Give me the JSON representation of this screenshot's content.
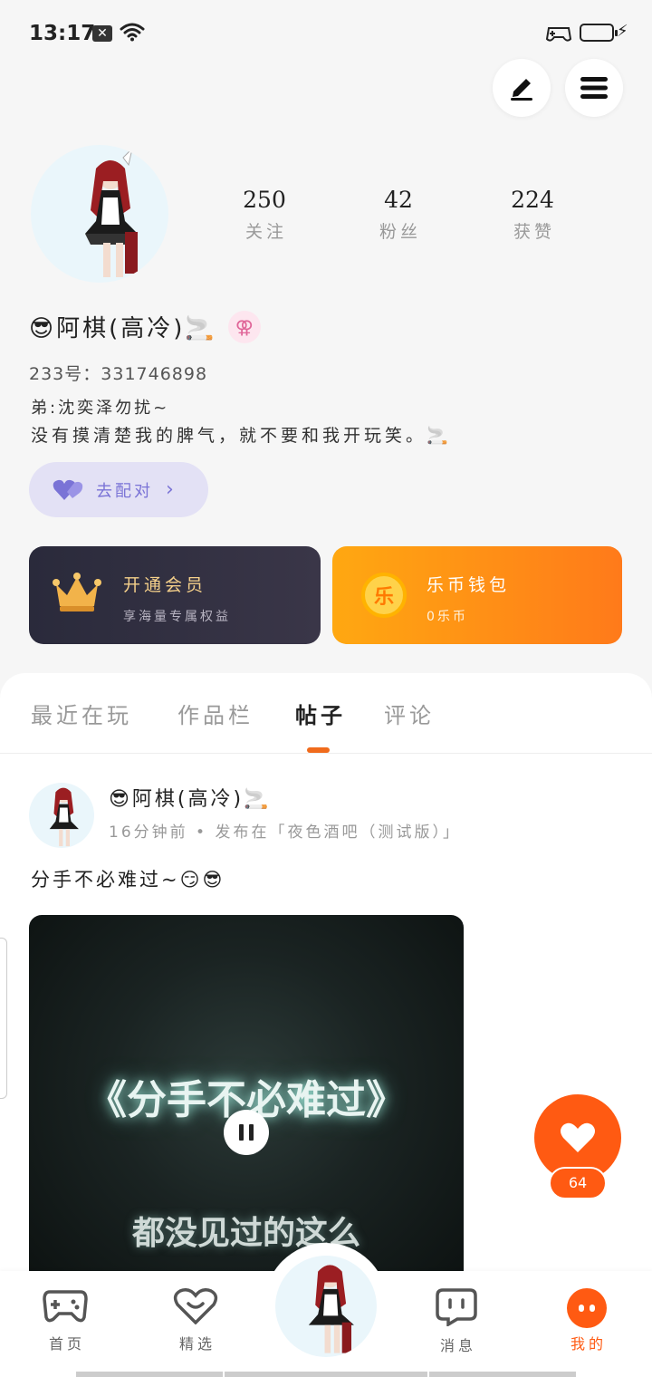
{
  "status_bar": {
    "time": "13:17"
  },
  "profile": {
    "stats": [
      {
        "num": "250",
        "label": "关注"
      },
      {
        "num": "42",
        "label": "粉丝"
      },
      {
        "num": "224",
        "label": "获赞"
      }
    ],
    "name": "😎阿棋(高冷)🚬",
    "gender_symbol": "⚢",
    "uid": "233号：331746898",
    "bio_line1": "弟:沈奕泽勿扰~",
    "bio_line2": "没有摸清楚我的脾气，就不要和我开玩笑。🚬",
    "match_label": "去配对"
  },
  "cards": {
    "vip_title": "开通会员",
    "vip_sub": "享海量专属权益",
    "wallet_title": "乐币钱包",
    "wallet_sub": "0乐币",
    "coin_char": "乐"
  },
  "tabs": [
    {
      "label": "最近在玩",
      "active": false
    },
    {
      "label": "作品栏",
      "active": false
    },
    {
      "label": "帖子",
      "active": true
    },
    {
      "label": "评论",
      "active": false
    }
  ],
  "post": {
    "author": "😎阿棋(高冷)🚬",
    "meta": "16分钟前 • 发布在「夜色酒吧（测试版）」",
    "text": "分手不必难过~😏😎",
    "video_title": "《分手不必难过》",
    "video_sub": "都没见过的这么",
    "like_count": "64"
  },
  "bottom_nav": [
    {
      "label": "首页",
      "icon": "gamepad-icon",
      "active": false
    },
    {
      "label": "精选",
      "icon": "heart-chat-icon",
      "active": false
    },
    {
      "label": "消息",
      "icon": "message-icon",
      "active": false
    },
    {
      "label": "我的",
      "icon": "face-icon",
      "active": true
    }
  ],
  "colors": {
    "accent": "#ff5a12",
    "tab_indicator": "#f06b1c",
    "match_purple": "#7a73d6",
    "vip_card": "#2a2a3b",
    "wallet_card": "#ff8c14"
  }
}
